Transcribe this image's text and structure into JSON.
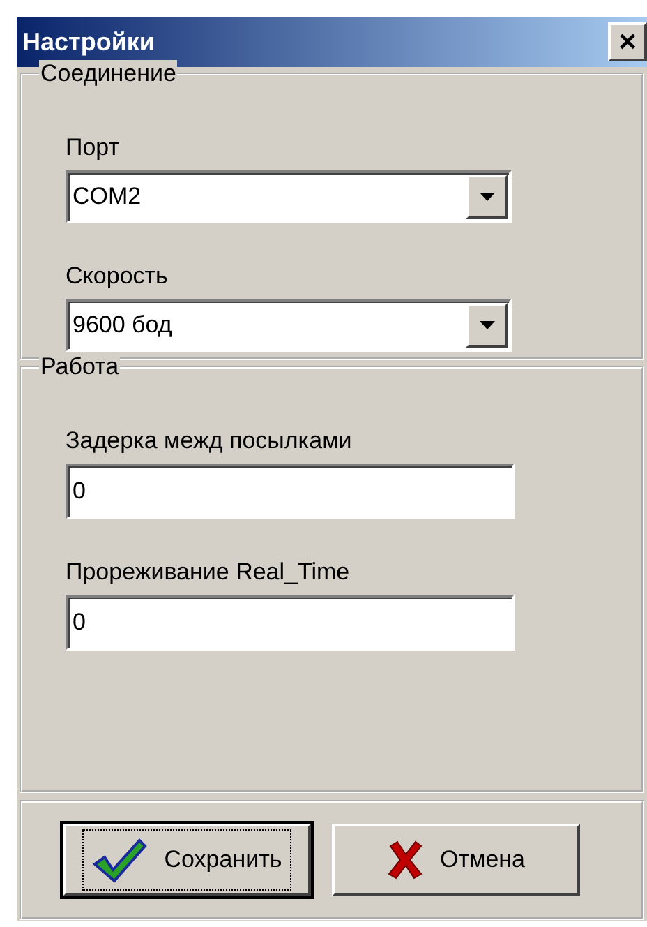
{
  "window": {
    "title": "Настройки",
    "close": "×"
  },
  "groups": [
    {
      "title": "Соединение",
      "fields": [
        {
          "kind": "combo",
          "label": "Порт",
          "value": "COM2"
        },
        {
          "kind": "combo",
          "label": "Скорость",
          "value": "9600 бод"
        }
      ]
    },
    {
      "title": "Работа",
      "fields": [
        {
          "kind": "text",
          "label": "Задерка межд посылками",
          "value": "0"
        },
        {
          "kind": "text",
          "label": "Прореживание Real_Time",
          "value": "0"
        }
      ]
    }
  ],
  "buttons": [
    {
      "kind": "save",
      "label": "Сохранить",
      "focused": true
    },
    {
      "kind": "cancel",
      "label": "Отмена",
      "focused": false
    }
  ]
}
